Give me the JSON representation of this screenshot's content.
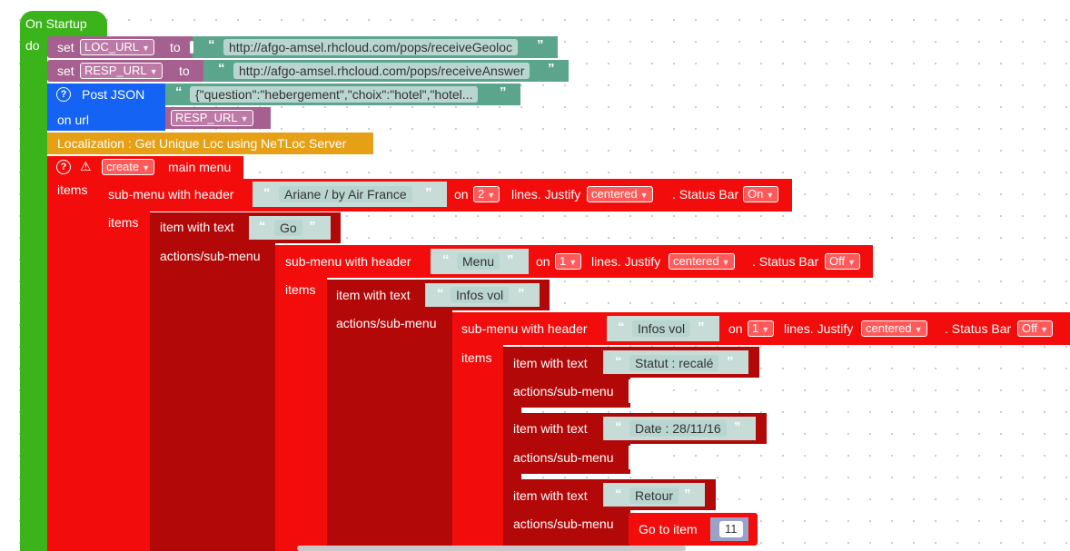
{
  "hat": {
    "title": "On Startup",
    "do_label": "do"
  },
  "set1": {
    "set_label": "set",
    "var": "LOC_URL",
    "to_label": "to",
    "value": "http://afgo-amsel.rhcloud.com/pops/receiveGeoloc"
  },
  "set2": {
    "set_label": "set",
    "var": "RESP_URL",
    "to_label": "to",
    "value": "http://afgo-amsel.rhcloud.com/pops/receiveAnswer"
  },
  "post": {
    "title": "Post JSON",
    "json": "{\"question\":\"hebergement\",\"choix\":\"hotel\",\"hotel...",
    "on_url_label": "on url",
    "url_var": "RESP_URL"
  },
  "localization": {
    "label": "Localization : Get Unique Loc using NeTLoc Server"
  },
  "menu": {
    "create_option": "create",
    "main_menu_label": "main menu",
    "items_label": "items"
  },
  "sub1": {
    "header_label": "sub-menu with header",
    "header": "Ariane / by Air France",
    "on_label": "on",
    "lines": "2",
    "lines_label": "lines. Justify",
    "justify": "centered",
    "status_label": ". Status Bar",
    "status": "On",
    "items_label": "items"
  },
  "item_go": {
    "label": "item with text",
    "text": "Go",
    "actions_label": "actions/sub-menu"
  },
  "sub2": {
    "header_label": "sub-menu with header",
    "header": "Menu",
    "on_label": "on",
    "lines": "1",
    "lines_label": "lines. Justify",
    "justify": "centered",
    "status_label": ". Status Bar",
    "status": "Off",
    "items_label": "items"
  },
  "item_infos": {
    "label": "item with text",
    "text": "Infos vol",
    "actions_label": "actions/sub-menu"
  },
  "sub3": {
    "header_label": "sub-menu with header",
    "header": "Infos vol",
    "on_label": "on",
    "lines": "1",
    "lines_label": "lines. Justify",
    "justify": "centered",
    "status_label": ". Status Bar",
    "status": "Off",
    "items_label": "items"
  },
  "item_statut": {
    "label": "item with text",
    "text": "Statut : recalé",
    "actions_label": "actions/sub-menu"
  },
  "item_date": {
    "label": "item with text",
    "text": "Date : 28/11/16",
    "actions_label": "actions/sub-menu"
  },
  "item_retour": {
    "label": "item with text",
    "text": "Retour",
    "actions_label": "actions/sub-menu"
  },
  "goto": {
    "label": "Go to item",
    "value": "11"
  },
  "icons": {
    "arrow": "▼",
    "open_quote": "“",
    "close_quote": "”",
    "help": "?",
    "warning": "⚠"
  },
  "colors": {
    "event": "#3bb31a",
    "variable": "#a5608f",
    "http": "#1463f5",
    "localization": "#e6a016",
    "menu": "#f20c0c",
    "menu_dark": "#b30808",
    "text": "#b9d5cf"
  }
}
